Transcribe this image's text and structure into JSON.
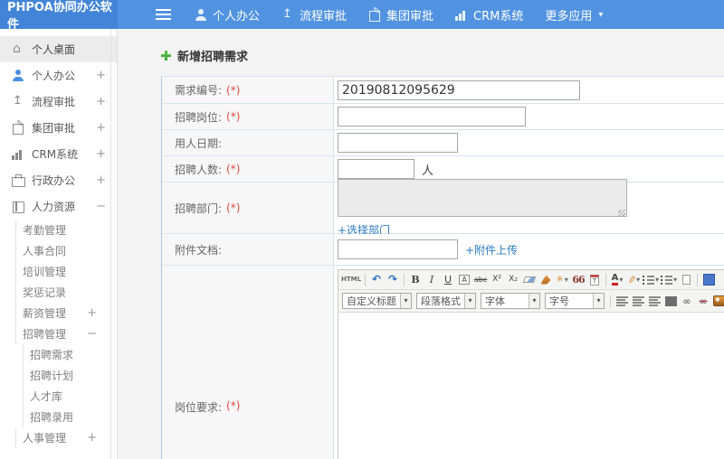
{
  "topbar": {
    "logo": "PHPOA协同办公软件",
    "nav": [
      {
        "name": "nav-personal-office",
        "label": "个人办公",
        "icon": "user-icon"
      },
      {
        "name": "nav-workflow-approval",
        "label": "流程审批",
        "icon": "flow-icon"
      },
      {
        "name": "nav-group-approval",
        "label": "集团审批",
        "icon": "edit-icon"
      },
      {
        "name": "nav-crm-system",
        "label": "CRM系统",
        "icon": "chart-icon"
      },
      {
        "name": "nav-more-apps",
        "label": "更多应用",
        "icon": "caret-down-icon"
      }
    ]
  },
  "sidebar": {
    "items": [
      {
        "name": "sidebar-item-personal-desktop",
        "label": "个人桌面",
        "icon": "home-icon",
        "level": 0,
        "active": true
      },
      {
        "name": "sidebar-item-personal-office",
        "label": "个人办公",
        "icon": "user-icon",
        "level": 0,
        "expander": "+",
        "blue": true
      },
      {
        "name": "sidebar-item-workflow-approval",
        "label": "流程审批",
        "icon": "flow-icon",
        "level": 0,
        "expander": "+"
      },
      {
        "name": "sidebar-item-group-approval",
        "label": "集团审批",
        "icon": "edit-icon",
        "level": 0,
        "expander": "+"
      },
      {
        "name": "sidebar-item-crm-system",
        "label": "CRM系统",
        "icon": "chart-icon",
        "level": 0,
        "expander": "+"
      },
      {
        "name": "sidebar-item-admin-office",
        "label": "行政办公",
        "icon": "briefcase-icon",
        "level": 0,
        "expander": "+"
      },
      {
        "name": "sidebar-item-human-resources",
        "label": "人力资源",
        "icon": "book-icon",
        "level": 0,
        "expander": "−"
      },
      {
        "name": "sidebar-item-attendance-management",
        "label": "考勤管理",
        "level": 1
      },
      {
        "name": "sidebar-item-personnel-contract",
        "label": "人事合同",
        "level": 1
      },
      {
        "name": "sidebar-item-training-management",
        "label": "培训管理",
        "level": 1
      },
      {
        "name": "sidebar-item-reward-punishment-records",
        "label": "奖惩记录",
        "level": 1
      },
      {
        "name": "sidebar-item-salary-management",
        "label": "薪资管理",
        "level": 1,
        "expander": "+"
      },
      {
        "name": "sidebar-item-recruitment-management",
        "label": "招聘管理",
        "level": 1,
        "expander": "−"
      },
      {
        "name": "sidebar-item-recruitment-requirements",
        "label": "招聘需求",
        "level": 2
      },
      {
        "name": "sidebar-item-recruitment-plan",
        "label": "招聘计划",
        "level": 2
      },
      {
        "name": "sidebar-item-talent-pool",
        "label": "人才库",
        "level": 2
      },
      {
        "name": "sidebar-item-recruitment-hiring",
        "label": "招聘录用",
        "level": 2
      },
      {
        "name": "sidebar-item-personnel-management",
        "label": "人事管理",
        "level": 1,
        "expander": "+"
      }
    ]
  },
  "main": {
    "title": "新增招聘需求",
    "form": {
      "req_no": {
        "label": "需求编号:",
        "required": "(*)",
        "value": "20190812095629"
      },
      "position": {
        "label": "招聘岗位:",
        "required": "(*)"
      },
      "date": {
        "label": "用人日期:"
      },
      "headcount": {
        "label": "招聘人数:",
        "required": "(*)",
        "suffix": "人"
      },
      "department": {
        "label": "招聘部门:",
        "required": "(*)",
        "link": "+选择部门"
      },
      "attachment": {
        "label": "附件文档:",
        "link": "+附件上传"
      },
      "job_req": {
        "label": "岗位要求:",
        "required": "(*)"
      }
    },
    "editor": {
      "toolbar1": [
        {
          "name": "html-source-icon",
          "glyph": "HTML"
        },
        {
          "name": "sep"
        },
        {
          "name": "undo-icon",
          "glyph": "↶"
        },
        {
          "name": "redo-icon",
          "glyph": "↷"
        },
        {
          "name": "sep"
        },
        {
          "name": "bold-icon",
          "glyph": "B"
        },
        {
          "name": "italic-icon",
          "glyph": "I"
        },
        {
          "name": "underline-icon",
          "glyph": "U"
        },
        {
          "name": "font-style-icon",
          "glyph": "A"
        },
        {
          "name": "strikethrough-icon",
          "glyph": "abc"
        },
        {
          "name": "superscript-icon",
          "glyph": "X²"
        },
        {
          "name": "subscript-icon",
          "glyph": "X₂"
        },
        {
          "name": "remove-format-icon",
          "glyph": ""
        },
        {
          "name": "format-brush-icon",
          "glyph": ""
        },
        {
          "name": "quick-format-icon",
          "glyph": "✳",
          "caret": true
        },
        {
          "name": "blockquote-icon",
          "glyph": "66"
        },
        {
          "name": "paste-text-icon",
          "glyph": "T"
        },
        {
          "name": "sep"
        },
        {
          "name": "font-color-icon",
          "glyph": "A",
          "caret": true
        },
        {
          "name": "highlight-icon",
          "glyph": "✎",
          "caret": true
        },
        {
          "name": "ordered-list-icon",
          "glyph": "",
          "caret": true
        },
        {
          "name": "unordered-list-icon",
          "glyph": "",
          "caret": true
        },
        {
          "name": "new-page-icon",
          "glyph": ""
        },
        {
          "name": "sep"
        },
        {
          "name": "media-icon",
          "glyph": ""
        }
      ],
      "toolbar2_selects": [
        {
          "name": "custom-title-select",
          "label": "自定义标题"
        },
        {
          "name": "paragraph-format-select",
          "label": "段落格式"
        },
        {
          "name": "font-family-select",
          "label": "字体"
        },
        {
          "name": "font-size-select",
          "label": "字号"
        }
      ],
      "toolbar2_icons": [
        {
          "name": "align-left-icon",
          "bars": true
        },
        {
          "name": "align-center-icon",
          "bars": true
        },
        {
          "name": "align-right-icon",
          "bars": true
        },
        {
          "name": "align-justify-icon",
          "bars": true
        },
        {
          "name": "link-icon",
          "glyph": "∞"
        },
        {
          "name": "unlink-icon",
          "glyph": "∞"
        },
        {
          "name": "image-icon"
        },
        {
          "name": "image-upload-icon"
        },
        {
          "name": "layout-icon"
        },
        {
          "name": "table-icon"
        }
      ]
    }
  },
  "colors": {
    "topbar_bg": "#5193e0",
    "logo_bg": "#4285d8",
    "accent_blue": "#4a90e2",
    "link_blue": "#2b7bc3",
    "required_red": "#e34b42",
    "row_border": "#d8e3ee"
  }
}
